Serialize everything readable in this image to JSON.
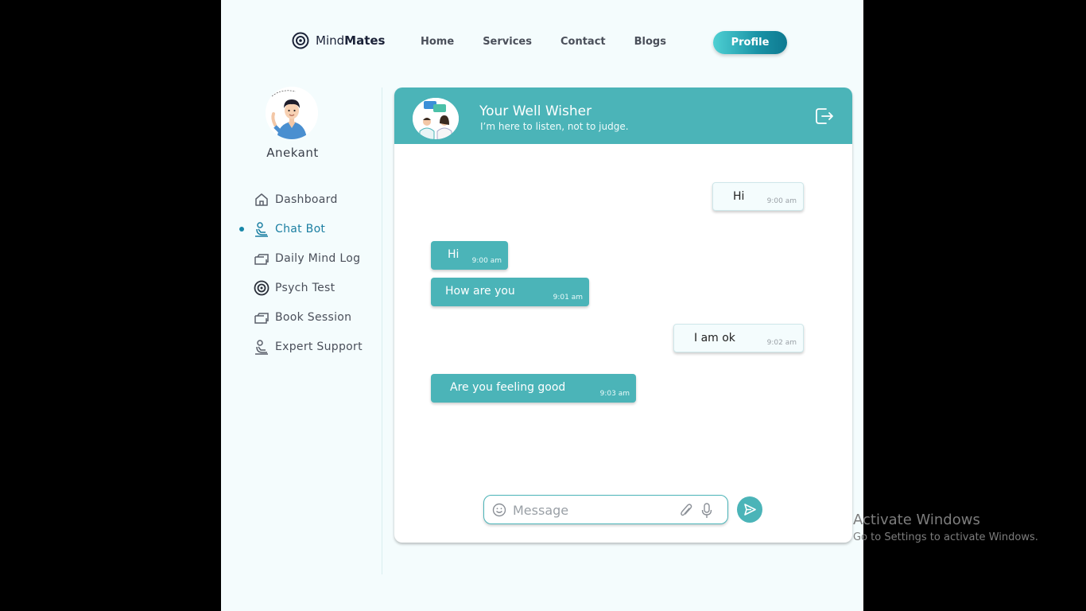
{
  "brand": {
    "name_light": "Mind",
    "name_bold": "Mates"
  },
  "nav": {
    "home": "Home",
    "services": "Services",
    "contact": "Contact",
    "blogs": "Blogs",
    "profile": "Profile"
  },
  "user": {
    "name": "Anekant"
  },
  "sidebar": {
    "items": [
      {
        "label": "Dashboard",
        "icon": "home-icon",
        "active": false
      },
      {
        "label": "Chat Bot",
        "icon": "chat-bot-icon",
        "active": true
      },
      {
        "label": "Daily Mind Log",
        "icon": "log-icon",
        "active": false
      },
      {
        "label": "Psych Test",
        "icon": "target-icon",
        "active": false
      },
      {
        "label": "Book Session",
        "icon": "book-icon",
        "active": false
      },
      {
        "label": "Expert Support",
        "icon": "support-icon",
        "active": false
      }
    ]
  },
  "chat": {
    "bot_name": "Your Well Wisher",
    "bot_tagline": "I’m here to listen, not to judge.",
    "messages": [
      {
        "from": "user",
        "text": "Hi",
        "time": "9:00 am"
      },
      {
        "from": "bot",
        "text": "Hi",
        "time": "9:00 am"
      },
      {
        "from": "bot",
        "text": "How are you",
        "time": "9:01 am"
      },
      {
        "from": "user",
        "text": "I am ok",
        "time": "9:02 am"
      },
      {
        "from": "bot",
        "text": "Are you feeling good",
        "time": "9:03 am"
      }
    ],
    "input_placeholder": "Message"
  },
  "watermark": {
    "title": "Activate Windows",
    "subtitle": "Go to Settings to activate Windows."
  },
  "colors": {
    "accent": "#4bb4b8",
    "active_link": "#1b7fa2",
    "page_bg": "#f4fcfd"
  }
}
